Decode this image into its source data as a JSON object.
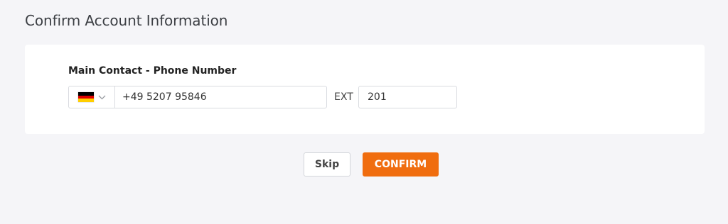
{
  "page": {
    "title": "Confirm Account Information"
  },
  "form": {
    "phone_label": "Main Contact - Phone Number",
    "country": {
      "icon": "germany-flag-icon",
      "flag_colors": [
        "#000000",
        "#dd0000",
        "#ffce00"
      ]
    },
    "phone_value": "+49 5207 95846",
    "ext_label": "EXT",
    "ext_value": "201"
  },
  "actions": {
    "skip_label": "Skip",
    "confirm_label": "CONFIRM",
    "accent_color": "#f06d0f"
  }
}
